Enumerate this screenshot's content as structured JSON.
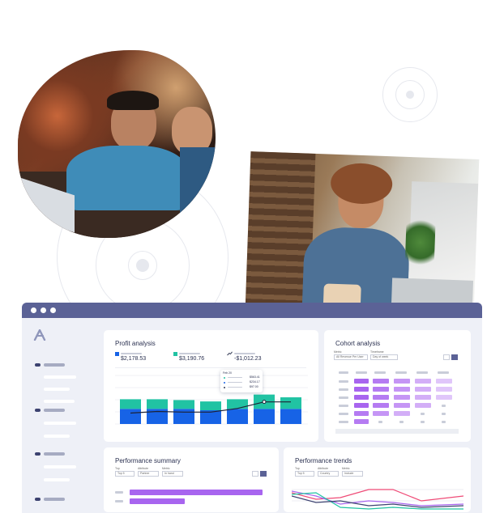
{
  "dashboard": {
    "profit_analysis": {
      "title": "Profit analysis",
      "metrics": [
        {
          "value": "$2,178.53",
          "color": "#1763e6"
        },
        {
          "value": "$3,190.76",
          "color": "#21c3a3"
        },
        {
          "value": "-$1,012.23",
          "color": "#333a55"
        }
      ],
      "tooltip": {
        "heading": "Feb 20",
        "rows": [
          {
            "value": "$563.41",
            "color": "#21c3a3"
          },
          {
            "value": "$234.17",
            "color": "#1763e6"
          },
          {
            "value": "$97.00",
            "color": "#333a55"
          }
        ]
      },
      "chart_data": {
        "type": "bar",
        "stacked": true,
        "series": [
          {
            "values": [
              0.55,
              0.55,
              0.55,
              0.5,
              0.55,
              0.55,
              0.55
            ],
            "color": "#1763e6"
          },
          {
            "values": [
              0.35,
              0.35,
              0.32,
              0.32,
              0.35,
              0.52,
              0.42
            ],
            "color": "#21c3a3"
          }
        ],
        "line": {
          "values": [
            0.33,
            0.38,
            0.36,
            0.36,
            0.47,
            0.67,
            0.67
          ],
          "color": "#1e2235"
        }
      }
    },
    "cohort_analysis": {
      "title": "Cohort analysis",
      "selects": [
        "All Revenue Per User",
        "Day of week"
      ]
    },
    "performance_summary": {
      "title": "Performance summary",
      "selects": [
        "Top 5",
        "Partner",
        "In hand"
      ]
    },
    "performance_trends": {
      "title": "Performance trends",
      "selects": [
        "Top 5",
        "Country",
        "Include"
      ]
    }
  },
  "colors": {
    "window_bar": "#5b6296",
    "sidebar_bg": "#eef0f7",
    "accent_blue": "#1763e6",
    "accent_teal": "#21c3a3",
    "accent_purple": "#a865ef"
  },
  "icons": {
    "brand": "logo-mark-icon"
  }
}
